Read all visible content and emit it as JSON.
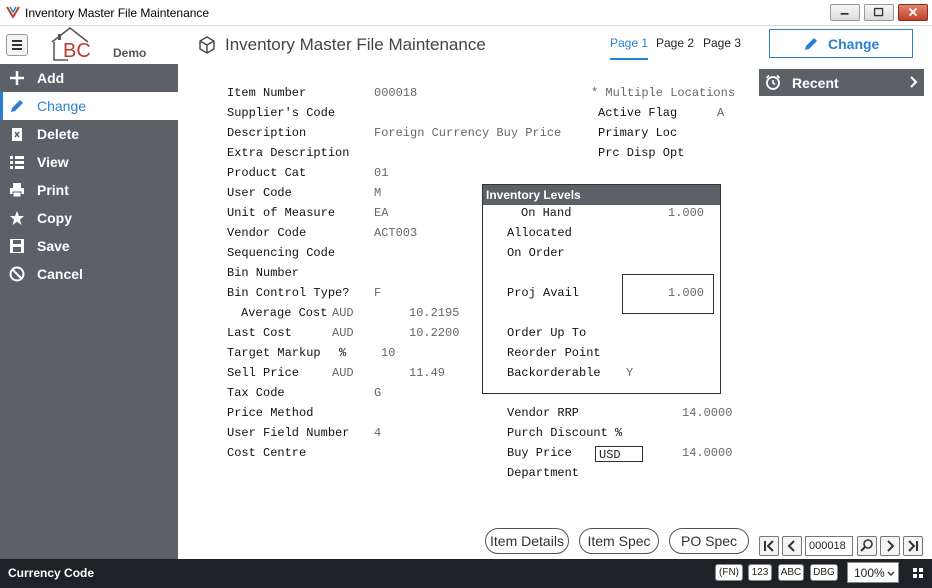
{
  "window": {
    "title": "Inventory Master File Maintenance"
  },
  "header": {
    "logo_text": "BC",
    "logo_sub": "Demo",
    "page_title": "Inventory Master File Maintenance",
    "tabs": [
      {
        "label": "Page 1",
        "active": true
      },
      {
        "label": "Page 2"
      },
      {
        "label": "Page 3"
      }
    ],
    "change_button": "Change",
    "accent_color": "#2b7fd0"
  },
  "sidebar": {
    "items": [
      {
        "label": "Add",
        "icon": "plus-icon"
      },
      {
        "label": "Change",
        "icon": "pencil-icon",
        "active": true
      },
      {
        "label": "Delete",
        "icon": "trash-icon"
      },
      {
        "label": "View",
        "icon": "list-icon"
      },
      {
        "label": "Print",
        "icon": "printer-icon"
      },
      {
        "label": "Copy",
        "icon": "star-icon"
      },
      {
        "label": "Save",
        "icon": "floppy-icon"
      },
      {
        "label": "Cancel",
        "icon": "cancel-icon"
      }
    ]
  },
  "recent": {
    "label": "Recent"
  },
  "form": {
    "item_number": {
      "label": "Item Number",
      "value": "000018"
    },
    "suppliers_code": {
      "label": "Supplier's Code",
      "value": ""
    },
    "description": {
      "label": "Description",
      "value": "Foreign Currency Buy Price"
    },
    "extra_description": {
      "label": "Extra Description",
      "value": ""
    },
    "product_cat": {
      "label": "Product Cat",
      "value": "01"
    },
    "user_code": {
      "label": "User Code",
      "value": "M"
    },
    "unit_of_measure": {
      "label": "Unit of Measure",
      "value": "EA"
    },
    "vendor_code": {
      "label": "Vendor Code",
      "value": "ACT003"
    },
    "sequencing_code": {
      "label": "Sequencing Code",
      "value": ""
    },
    "bin_number": {
      "label": "Bin Number",
      "value": ""
    },
    "bin_control_type": {
      "label": "Bin Control Type?",
      "value": "F"
    },
    "average_cost": {
      "label": "Average Cost",
      "currency": "AUD",
      "value": "10.2195"
    },
    "last_cost": {
      "label": "Last Cost",
      "currency": "AUD",
      "value": "10.2200"
    },
    "target_markup": {
      "label": "Target Markup",
      "unit": "%",
      "value": "10"
    },
    "sell_price": {
      "label": "Sell Price",
      "currency": "AUD",
      "value": "11.49"
    },
    "tax_code": {
      "label": "Tax Code",
      "value": "G"
    },
    "price_method": {
      "label": "Price Method",
      "value": ""
    },
    "user_field_number": {
      "label": "User Field Number",
      "value": "4"
    },
    "cost_centre": {
      "label": "Cost Centre",
      "value": ""
    },
    "multiple_locations": "* Multiple Locations",
    "active_flag": {
      "label": "Active Flag",
      "value": "A"
    },
    "primary_loc": {
      "label": "Primary Loc",
      "value": ""
    },
    "prc_disp_opt": {
      "label": "Prc Disp Opt",
      "value": ""
    },
    "inventory_levels": {
      "title": "Inventory Levels",
      "on_hand": {
        "label": "On Hand",
        "value": "1.000"
      },
      "allocated": {
        "label": "Allocated",
        "value": ""
      },
      "on_order": {
        "label": "On Order",
        "value": ""
      },
      "proj_avail": {
        "label": "Proj Avail",
        "value": "1.000"
      },
      "order_up_to": {
        "label": "Order Up To",
        "value": ""
      },
      "reorder_point": {
        "label": "Reorder Point",
        "value": ""
      },
      "backorderable": {
        "label": "Backorderable",
        "value": "Y"
      }
    },
    "vendor_rrp": {
      "label": "Vendor RRP",
      "value": "14.0000"
    },
    "purch_discount": {
      "label": "Purch Discount %",
      "value": ""
    },
    "buy_price": {
      "label": "Buy Price",
      "currency": "USD",
      "value": "14.0000"
    },
    "department": {
      "label": "Department",
      "value": ""
    }
  },
  "footer": {
    "buttons": {
      "item_details": "Item Details",
      "item_spec": "Item Spec",
      "po_spec": "PO Spec"
    },
    "record": "000018"
  },
  "statusbar": {
    "text": "Currency Code",
    "badges": [
      "(FN)",
      "123",
      "ABC",
      "DBG"
    ],
    "zoom": "100%"
  }
}
